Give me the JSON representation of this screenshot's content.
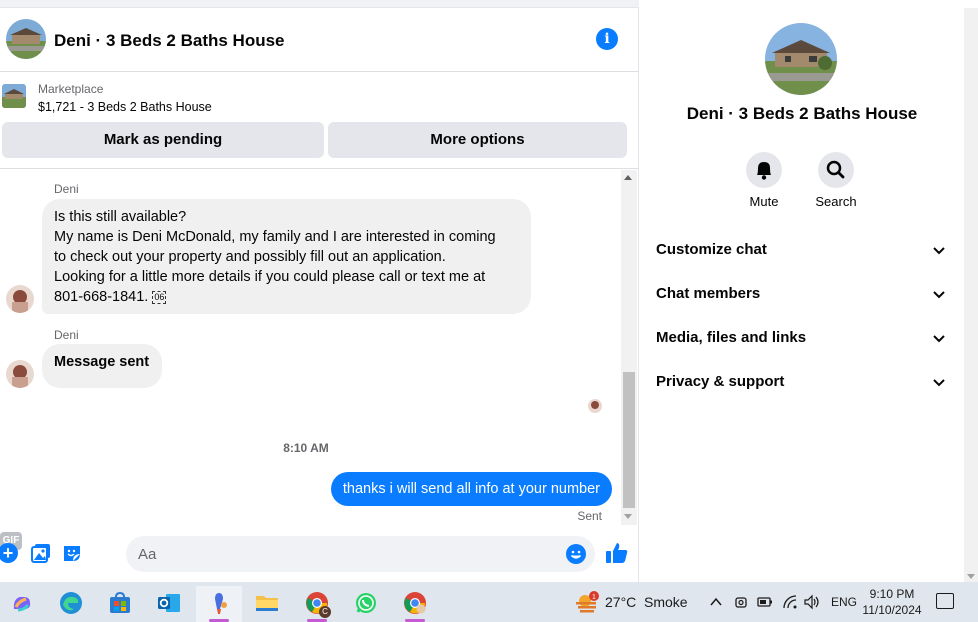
{
  "header": {
    "title": "Deni · 3 Beds 2 Baths House"
  },
  "marketplace": {
    "label": "Marketplace",
    "listing": "$1,721 - 3 Beds 2 Baths House",
    "buttons": {
      "pending": "Mark as pending",
      "more": "More options"
    }
  },
  "messages": [
    {
      "sender": "Deni",
      "lines": [
        "Is this still available?",
        "My name is Deni McDonald, my family and I are interested in coming",
        "to check out your property and possibly fill out an application.",
        "Looking for a little more details if you could please call or text me at",
        "801-668-1841."
      ],
      "glyph": "06"
    },
    {
      "sender": "Deni",
      "text": "Message sent"
    }
  ],
  "timestamp": "8:10 AM",
  "outgoing": {
    "text": "thanks i will send all info at your number",
    "status": "Sent"
  },
  "composer": {
    "placeholder": "Aa",
    "gif_label": "GIF"
  },
  "sidebar": {
    "title": "Deni · 3 Beds 2 Baths House",
    "actions": {
      "mute": "Mute",
      "search": "Search"
    },
    "sections": [
      "Customize chat",
      "Chat members",
      "Media, files and links",
      "Privacy & support"
    ]
  },
  "taskbar": {
    "weather_temp": "27°C",
    "weather_cond": "Smoke",
    "weather_badge": "1",
    "language": "ENG",
    "time": "9:10 PM",
    "date": "11/10/2024",
    "chrome_badge": "C"
  },
  "colors": {
    "accent": "#0a7cff",
    "bubble_in": "#f0f0f0",
    "button_bg": "#e4e6eb"
  }
}
